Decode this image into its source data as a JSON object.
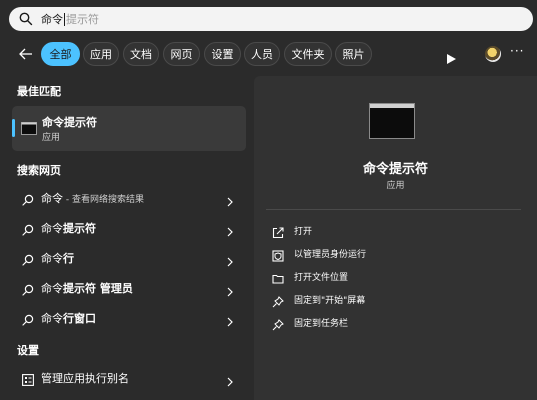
{
  "search": {
    "typed": "命令",
    "suggestion": "提示符"
  },
  "filters": [
    "全部",
    "应用",
    "文档",
    "网页",
    "设置",
    "人员",
    "文件夹",
    "照片"
  ],
  "left": {
    "best_match_title": "最佳匹配",
    "best_match": {
      "name": "命令提示符",
      "type": "应用"
    },
    "web_title": "搜索网页",
    "web_results": [
      {
        "bold": "命令",
        "rest": "",
        "sub": " - 查看网络搜索结果"
      },
      {
        "bold": "命令",
        "rest": "提示符",
        "sub": ""
      },
      {
        "bold": "命令",
        "rest": "行",
        "sub": ""
      },
      {
        "bold": "命令",
        "rest": "提示符 管理员",
        "sub": ""
      },
      {
        "bold": "命令",
        "rest": "行窗口",
        "sub": ""
      }
    ],
    "settings_title": "设置",
    "settings_result": "管理应用执行别名"
  },
  "right": {
    "app_name": "命令提示符",
    "app_type": "应用",
    "actions": [
      {
        "label": "打开",
        "icon": "open-icon"
      },
      {
        "label": "以管理员身份运行",
        "icon": "shield-icon"
      },
      {
        "label": "打开文件位置",
        "icon": "folder-icon"
      },
      {
        "label": "固定到\"开始\"屏幕",
        "icon": "pin-icon"
      },
      {
        "label": "固定到任务栏",
        "icon": "pin-icon"
      }
    ]
  },
  "colors": {
    "accent": "#4cc2ff",
    "background": "#2b2b2b",
    "panel": "#323232"
  }
}
